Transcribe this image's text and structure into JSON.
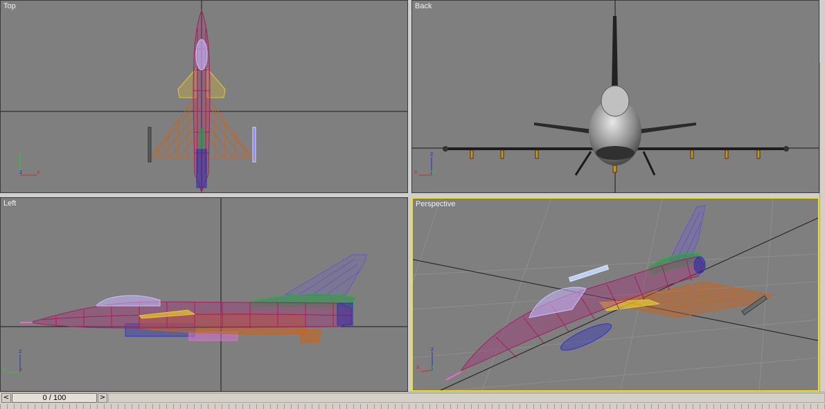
{
  "viewports": {
    "top": {
      "label": "Top"
    },
    "back": {
      "label": "Back"
    },
    "left": {
      "label": "Left"
    },
    "perspective": {
      "label": "Perspective"
    }
  },
  "axes": {
    "x": "x",
    "y": "y",
    "z": "z"
  },
  "timebar": {
    "prev_icon": "<",
    "next_icon": ">",
    "frame_display": "0 / 100"
  },
  "colors": {
    "viewport_bg": "#7f7f7f",
    "active_border": "#f2e21a",
    "fuselage": "#a0205a",
    "wing": "#c8641e",
    "canard": "#e8c832",
    "fin": "#6a54c8"
  }
}
